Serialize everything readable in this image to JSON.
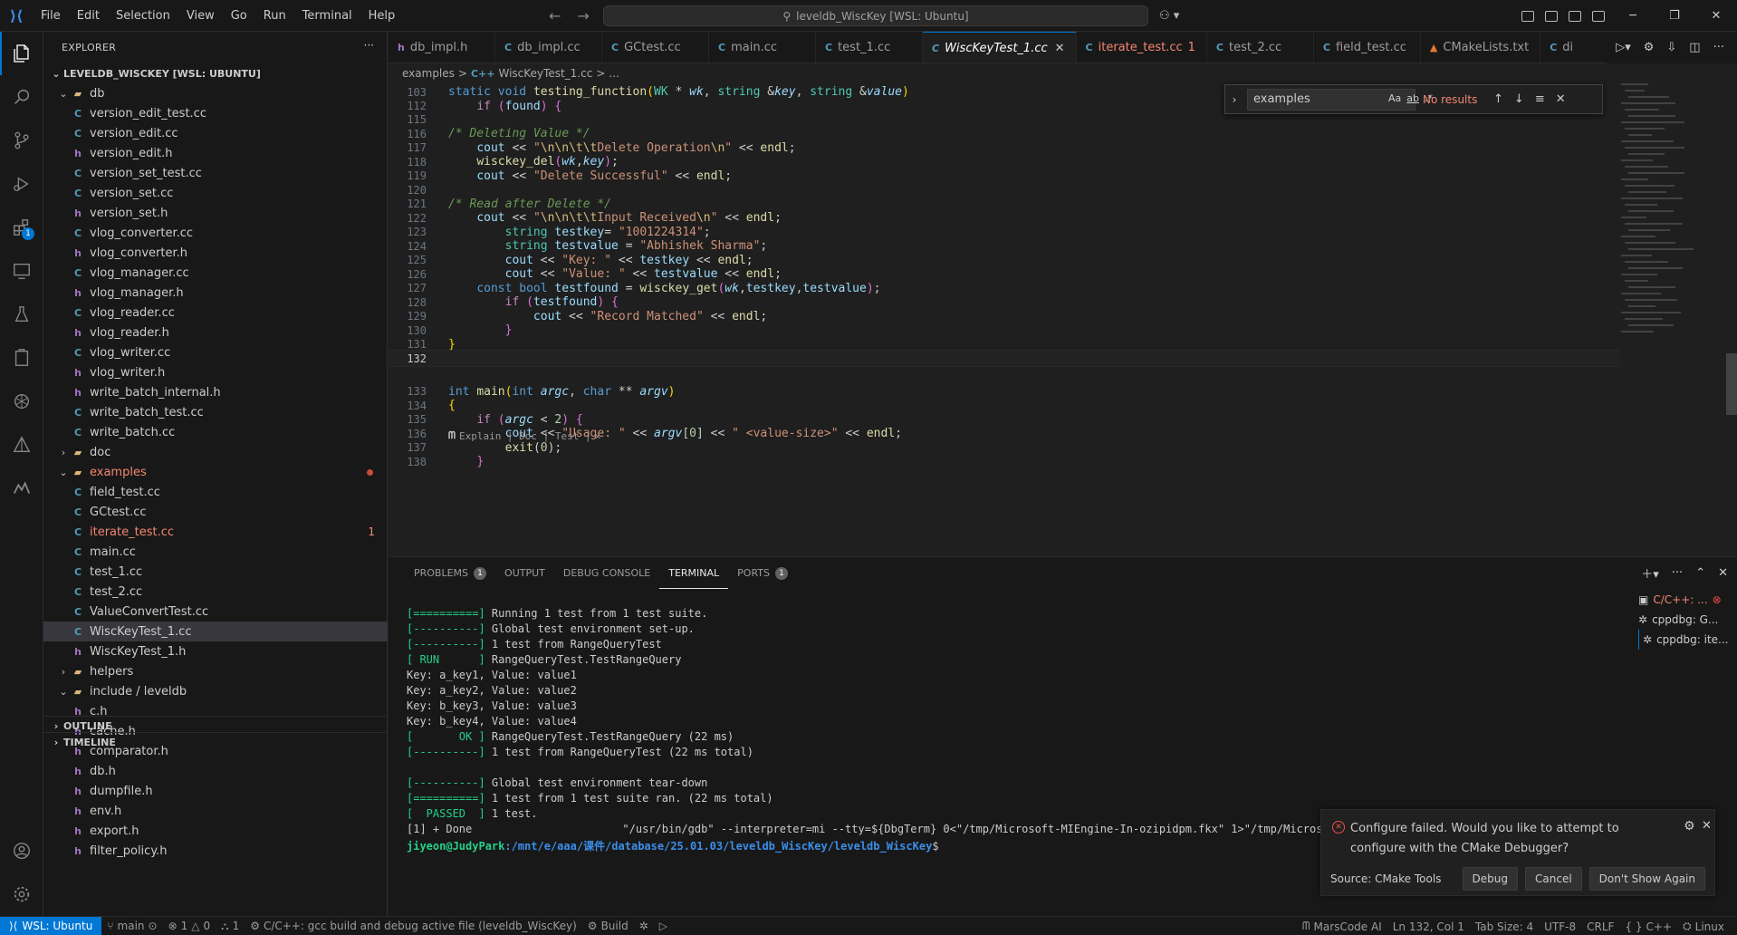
{
  "titlebar": {
    "menu": [
      "File",
      "Edit",
      "Selection",
      "View",
      "Go",
      "Run",
      "Terminal",
      "Help"
    ],
    "search": "leveldb_WiscKey [WSL: Ubuntu]"
  },
  "sidebar": {
    "title": "EXPLORER",
    "root": "LEVELDB_WISCKEY [WSL: UBUNTU]",
    "items": [
      {
        "label": "version_edit_test.cc",
        "type": "cc",
        "depth": 2
      },
      {
        "label": "version_edit.cc",
        "type": "cc",
        "depth": 2
      },
      {
        "label": "version_edit.h",
        "type": "h",
        "depth": 2
      },
      {
        "label": "version_set_test.cc",
        "type": "cc",
        "depth": 2
      },
      {
        "label": "version_set.cc",
        "type": "cc",
        "depth": 2
      },
      {
        "label": "version_set.h",
        "type": "h",
        "depth": 2
      },
      {
        "label": "vlog_converter.cc",
        "type": "cc",
        "depth": 2
      },
      {
        "label": "vlog_converter.h",
        "type": "h",
        "depth": 2
      },
      {
        "label": "vlog_manager.cc",
        "type": "cc",
        "depth": 2
      },
      {
        "label": "vlog_manager.h",
        "type": "h",
        "depth": 2
      },
      {
        "label": "vlog_reader.cc",
        "type": "cc",
        "depth": 2
      },
      {
        "label": "vlog_reader.h",
        "type": "h",
        "depth": 2
      },
      {
        "label": "vlog_writer.cc",
        "type": "cc",
        "depth": 2
      },
      {
        "label": "vlog_writer.h",
        "type": "h",
        "depth": 2
      },
      {
        "label": "write_batch_internal.h",
        "type": "h",
        "depth": 2
      },
      {
        "label": "write_batch_test.cc",
        "type": "cc",
        "depth": 2
      },
      {
        "label": "write_batch.cc",
        "type": "cc",
        "depth": 2
      },
      {
        "label": "doc",
        "type": "folder",
        "depth": 1,
        "open": false
      },
      {
        "label": "examples",
        "type": "folder",
        "depth": 1,
        "open": true,
        "err": true,
        "dot": true
      },
      {
        "label": "field_test.cc",
        "type": "cc",
        "depth": 2
      },
      {
        "label": "GCtest.cc",
        "type": "cc",
        "depth": 2
      },
      {
        "label": "iterate_test.cc",
        "type": "cc",
        "depth": 2,
        "err": true,
        "count": "1"
      },
      {
        "label": "main.cc",
        "type": "cc",
        "depth": 2
      },
      {
        "label": "test_1.cc",
        "type": "cc",
        "depth": 2
      },
      {
        "label": "test_2.cc",
        "type": "cc",
        "depth": 2
      },
      {
        "label": "ValueConvertTest.cc",
        "type": "cc",
        "depth": 2
      },
      {
        "label": "WiscKeyTest_1.cc",
        "type": "cc",
        "depth": 2,
        "selected": true
      },
      {
        "label": "WiscKeyTest_1.h",
        "type": "h",
        "depth": 2
      },
      {
        "label": "helpers",
        "type": "folder",
        "depth": 1,
        "open": false
      },
      {
        "label": "include / leveldb",
        "type": "folder",
        "depth": 1,
        "open": true
      },
      {
        "label": "c.h",
        "type": "h",
        "depth": 2
      },
      {
        "label": "cache.h",
        "type": "h",
        "depth": 2
      },
      {
        "label": "comparator.h",
        "type": "h",
        "depth": 2
      },
      {
        "label": "db.h",
        "type": "h",
        "depth": 2
      },
      {
        "label": "dumpfile.h",
        "type": "h",
        "depth": 2
      },
      {
        "label": "env.h",
        "type": "h",
        "depth": 2
      },
      {
        "label": "export.h",
        "type": "h",
        "depth": 2
      },
      {
        "label": "filter_policy.h",
        "type": "h",
        "depth": 2
      }
    ],
    "outline": "OUTLINE",
    "timeline": "TIMELINE"
  },
  "tabs": [
    {
      "label": "db_impl.h",
      "type": "h"
    },
    {
      "label": "db_impl.cc",
      "type": "cc"
    },
    {
      "label": "GCtest.cc",
      "type": "cc"
    },
    {
      "label": "main.cc",
      "type": "cc"
    },
    {
      "label": "test_1.cc",
      "type": "cc"
    },
    {
      "label": "WiscKeyTest_1.cc",
      "type": "cc",
      "active": true
    },
    {
      "label": "iterate_test.cc",
      "type": "cc",
      "err": true,
      "count": "1"
    },
    {
      "label": "test_2.cc",
      "type": "cc"
    },
    {
      "label": "field_test.cc",
      "type": "cc"
    },
    {
      "label": "CMakeLists.txt",
      "type": "cmake"
    },
    {
      "label": "di",
      "type": "cc"
    }
  ],
  "breadcrumb": [
    "examples",
    ">",
    "WiscKeyTest_1.cc",
    ">",
    "..."
  ],
  "editor": {
    "codelens": "Explain | Doc | Test |",
    "lines": [
      {
        "n": "103",
        "html": "<span class=\"kw\">static</span> <span class=\"kw\">void</span> <span class=\"fn\">testing_function</span><span class=\"br\">(</span><span class=\"ty\">WK</span> * <span class=\"pm\">wk</span>, <span class=\"ty\">string</span> &amp;<span class=\"pm\">key</span>, <span class=\"ty\">string</span> &amp;<span class=\"pm\">value</span><span class=\"br\">)</span>"
      },
      {
        "n": "112",
        "html": "    <span class=\"ctl\">if</span> <span class=\"br2\">(</span><span class=\"vr\">found</span><span class=\"br2\">)</span> <span class=\"br2\">{</span>"
      },
      {
        "n": "115",
        "html": ""
      },
      {
        "n": "116",
        "html": "<span class=\"cm\">/* Deleting Value */</span>"
      },
      {
        "n": "117",
        "html": "    <span class=\"vr\">cout</span> &lt;&lt; <span class=\"str\">\"</span><span class=\"esc\">\\n\\n\\t\\t</span><span class=\"str\">Delete Operation</span><span class=\"esc\">\\n</span><span class=\"str\">\"</span> &lt;&lt; <span class=\"fn\">endl</span>;"
      },
      {
        "n": "118",
        "html": "    <span class=\"fn\">wisckey_del</span><span class=\"br2\">(</span><span class=\"pm\">wk</span>,<span class=\"pm\">key</span><span class=\"br2\">)</span>;"
      },
      {
        "n": "119",
        "html": "    <span class=\"vr\">cout</span> &lt;&lt; <span class=\"str\">\"Delete Successful\"</span> &lt;&lt; <span class=\"fn\">endl</span>;"
      },
      {
        "n": "120",
        "html": ""
      },
      {
        "n": "121",
        "html": "<span class=\"cm\">/* Read after Delete */</span>"
      },
      {
        "n": "122",
        "html": "    <span class=\"vr\">cout</span> &lt;&lt; <span class=\"str\">\"</span><span class=\"esc\">\\n\\n\\t\\t</span><span class=\"str\">Input Received</span><span class=\"esc\">\\n</span><span class=\"str\">\"</span> &lt;&lt; <span class=\"fn\">endl</span>;"
      },
      {
        "n": "123",
        "html": "        <span class=\"ty\">string</span> <span class=\"vr\">testkey</span>= <span class=\"str\">\"1001224314\"</span>;"
      },
      {
        "n": "124",
        "html": "        <span class=\"ty\">string</span> <span class=\"vr\">testvalue</span> = <span class=\"str\">\"Abhishek Sharma\"</span>;"
      },
      {
        "n": "125",
        "html": "        <span class=\"vr\">cout</span> &lt;&lt; <span class=\"str\">\"Key: \"</span> &lt;&lt; <span class=\"vr\">testkey</span> &lt;&lt; <span class=\"fn\">endl</span>;"
      },
      {
        "n": "126",
        "html": "        <span class=\"vr\">cout</span> &lt;&lt; <span class=\"str\">\"Value: \"</span> &lt;&lt; <span class=\"vr\">testvalue</span> &lt;&lt; <span class=\"fn\">endl</span>;"
      },
      {
        "n": "127",
        "html": "    <span class=\"kw\">const</span> <span class=\"kw\">bool</span> <span class=\"vr\">testfound</span> = <span class=\"fn\">wisckey_get</span><span class=\"br2\">(</span><span class=\"pm\">wk</span>,<span class=\"vr\">testkey</span>,<span class=\"vr\">testvalue</span><span class=\"br2\">)</span>;"
      },
      {
        "n": "128",
        "html": "        <span class=\"ctl\">if</span> <span class=\"br2\">(</span><span class=\"vr\">testfound</span><span class=\"br2\">)</span> <span class=\"br2\">{</span>"
      },
      {
        "n": "129",
        "html": "            <span class=\"vr\">cout</span> &lt;&lt; <span class=\"str\">\"Record Matched\"</span> &lt;&lt; <span class=\"fn\">endl</span>;"
      },
      {
        "n": "130",
        "html": "        <span class=\"br2\">}</span>"
      },
      {
        "n": "131",
        "html": "<span class=\"br\">}</span>"
      },
      {
        "n": "132",
        "html": "",
        "current": true
      },
      {
        "n": "133",
        "html": "<span class=\"kw\">int</span> <span class=\"fn\">main</span><span class=\"br\">(</span><span class=\"kw\">int</span> <span class=\"pm\">argc</span>, <span class=\"kw\">char</span> ** <span class=\"pm\">argv</span><span class=\"br\">)</span>",
        "lensBefore": true
      },
      {
        "n": "134",
        "html": "<span class=\"br\">{</span>"
      },
      {
        "n": "135",
        "html": "    <span class=\"ctl\">if</span> <span class=\"br2\">(</span><span class=\"pm\">argc</span> &lt; <span class=\"nm\">2</span><span class=\"br2\">)</span> <span class=\"br2\">{</span>"
      },
      {
        "n": "136",
        "html": "        <span class=\"vr\">cout</span> &lt;&lt; <span class=\"str\">\"Usage: \"</span> &lt;&lt; <span class=\"pm\">argv</span>[<span class=\"nm\">0</span>] &lt;&lt; <span class=\"str\">\" &lt;value-size&gt;\"</span> &lt;&lt; <span class=\"fn\">endl</span>;"
      },
      {
        "n": "137",
        "html": "        <span class=\"fn\">exit</span>(<span class=\"nm\">0</span>);"
      },
      {
        "n": "138",
        "html": "    <span class=\"br2\">}</span>"
      }
    ]
  },
  "find": {
    "value": "examples",
    "result": "No results",
    "opt_case": "Aa",
    "opt_word": "ab",
    "opt_regex": ".*"
  },
  "panel": {
    "tabs": [
      {
        "label": "PROBLEMS",
        "badge": "1"
      },
      {
        "label": "OUTPUT"
      },
      {
        "label": "DEBUG CONSOLE"
      },
      {
        "label": "TERMINAL",
        "active": true
      },
      {
        "label": "PORTS",
        "badge": "1"
      }
    ],
    "terminal": [
      {
        "g": "[==========]",
        "t": " Running 1 test from 1 test suite."
      },
      {
        "g": "[----------]",
        "t": " Global test environment set-up."
      },
      {
        "g": "[----------]",
        "t": " 1 test from RangeQueryTest"
      },
      {
        "g": "[ RUN      ]",
        "t": " RangeQueryTest.TestRangeQuery"
      },
      {
        "g": "",
        "t": "Key: a_key1, Value: value1"
      },
      {
        "g": "",
        "t": "Key: a_key2, Value: value2"
      },
      {
        "g": "",
        "t": "Key: b_key3, Value: value3"
      },
      {
        "g": "",
        "t": "Key: b_key4, Value: value4"
      },
      {
        "g": "[       OK ]",
        "t": " RangeQueryTest.TestRangeQuery (22 ms)"
      },
      {
        "g": "[----------]",
        "t": " 1 test from RangeQueryTest (22 ms total)"
      },
      {
        "g": "",
        "t": ""
      },
      {
        "g": "[----------]",
        "t": " Global test environment tear-down"
      },
      {
        "g": "[==========]",
        "t": " 1 test from 1 test suite ran. (22 ms total)"
      },
      {
        "g": "[  PASSED  ]",
        "t": " 1 test."
      },
      {
        "g": "",
        "t": "[1] + Done                       \"/usr/bin/gdb\" --interpreter=mi --tty=${DbgTerm} 0<\"/tmp/Microsoft-MIEngine-In-ozipidpm.fkx\" 1>\"/tmp/Microsoft-MI"
      }
    ],
    "prompt_user": "jiyeon@JudyPark",
    "prompt_path": ":/mnt/e/aaa/课件/database/25.01.03/leveldb_WiscKey/leveldb_WiscKey",
    "prompt_end": "$",
    "terminal_list": [
      {
        "label": "C/C++: ...",
        "err": true
      },
      {
        "label": "cppdbg: G..."
      },
      {
        "label": "cppdbg: ite...",
        "active": true
      }
    ]
  },
  "toast": {
    "message": "Configure failed. Would you like to attempt to configure with the CMake Debugger?",
    "source": "Source: CMake Tools",
    "btn_debug": "Debug",
    "btn_cancel": "Cancel",
    "btn_dont": "Don't Show Again"
  },
  "statusbar": {
    "remote": "WSL: Ubuntu",
    "branch": "main",
    "errors": "1",
    "warnings": "0",
    "ports": "1",
    "task": "C/C++: gcc build and debug active file (leveldb_WiscKey)",
    "build": "Build",
    "marscode": "MarsCode AI",
    "position": "Ln 132, Col 1",
    "tabsize": "Tab Size: 4",
    "encoding": "UTF-8",
    "eol": "CRLF",
    "lang": "C++",
    "os": "Linux"
  },
  "colors": {
    "accent": "#0078d4",
    "error": "#f48771",
    "terminal_green": "#23d18b"
  }
}
